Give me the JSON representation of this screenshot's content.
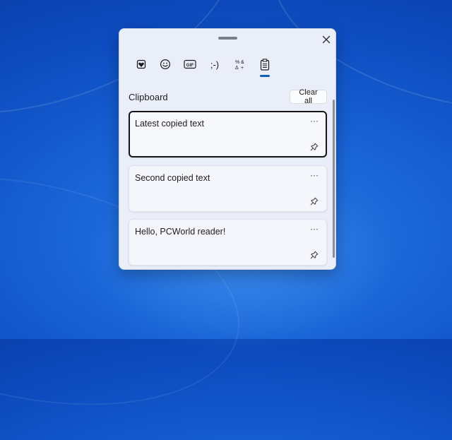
{
  "emoji_panel": {
    "tabs": [
      {
        "name": "kaomoji-favorites",
        "icon": "heart-favorites-icon"
      },
      {
        "name": "emoji",
        "icon": "smiley-icon"
      },
      {
        "name": "gif",
        "icon": "gif-icon",
        "label": "GIF"
      },
      {
        "name": "kaomoji",
        "icon": "kaomoji-icon",
        "label": ";-)"
      },
      {
        "name": "symbols",
        "icon": "symbols-icon"
      },
      {
        "name": "clipboard",
        "icon": "clipboard-icon",
        "active": true
      }
    ],
    "clipboard": {
      "title": "Clipboard",
      "clear_all_label": "Clear all",
      "items": [
        {
          "text": "Latest copied text",
          "selected": true
        },
        {
          "text": "Second copied text",
          "selected": false
        },
        {
          "text": "Hello, PCWorld reader!",
          "selected": false
        }
      ],
      "more_label": "···"
    },
    "accent_color": "#0f5fb8"
  }
}
